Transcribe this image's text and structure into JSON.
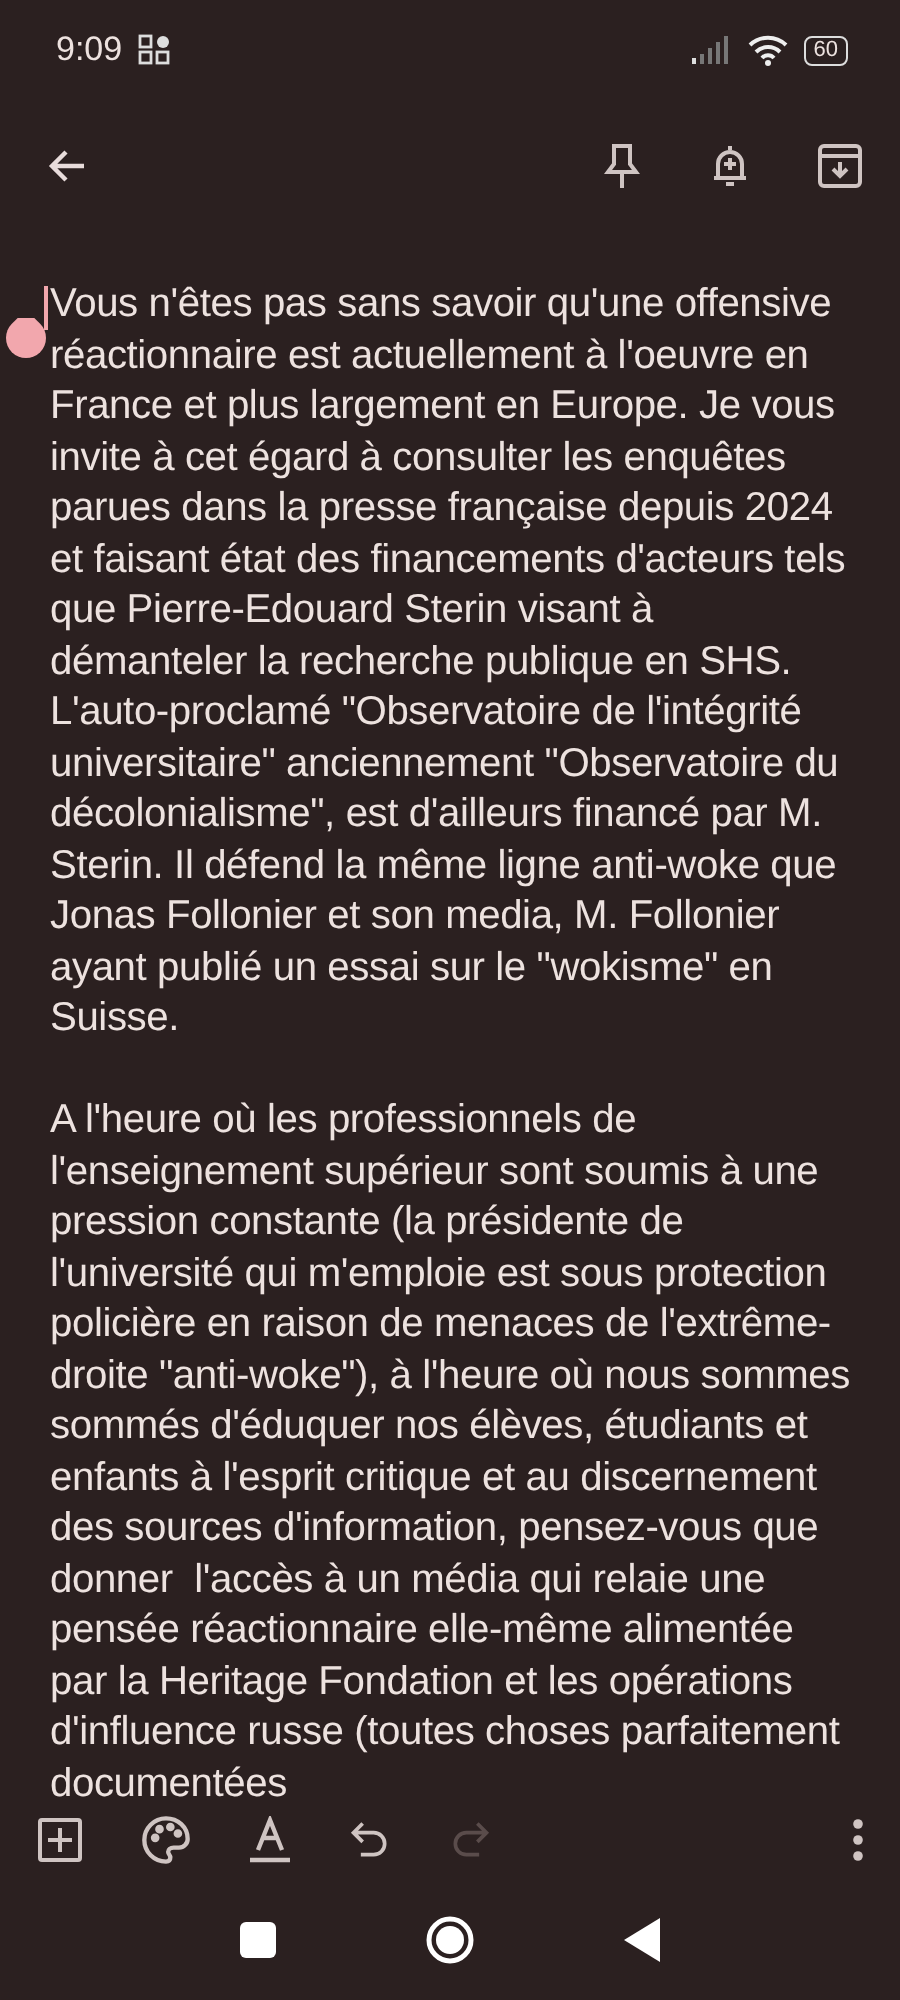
{
  "status_bar": {
    "time": "9:09",
    "battery": "60"
  },
  "note": {
    "paragraphs": [
      "Vous n'êtes pas sans savoir qu'une offensive réactionnaire est actuellement à l'oeuvre en France et plus largement en Europe. Je vous invite à cet égard à consulter les enquêtes parues dans la presse française depuis 2024 et faisant état des financements d'acteurs tels que Pierre-Edouard Sterin visant à démanteler la recherche publique en SHS. L'auto-proclamé \"Observatoire de l'intégrité universitaire\" anciennement \"Observatoire du décolonialisme\", est d'ailleurs financé par M. Sterin. Il défend la même ligne anti-woke que Jonas Follonier et son media, M. Follonier ayant publié un essai sur le \"wokisme\" en Suisse.",
      "A l'heure où les professionnels de l'enseignement supérieur sont soumis à une pression constante (la présidente de l'université qui m'emploie est sous protection policière en raison de menaces de l'extrême-droite \"anti-woke\"), à l'heure où nous sommes sommés d'éduquer nos élèves, étudiants et enfants à l'esprit critique et au discernement des sources d'information, pensez-vous que donner  l'accès à un média qui relaie une pensée réactionnaire elle-même alimentée par la Heritage Fondation et les opérations d'influence russe (toutes choses parfaitement documentées"
    ]
  },
  "toolbar": [
    {
      "kind": "add",
      "disabled": false
    },
    {
      "kind": "palette",
      "disabled": false
    },
    {
      "kind": "format",
      "disabled": false
    },
    {
      "kind": "undo",
      "disabled": false
    },
    {
      "kind": "redo",
      "disabled": true
    }
  ]
}
